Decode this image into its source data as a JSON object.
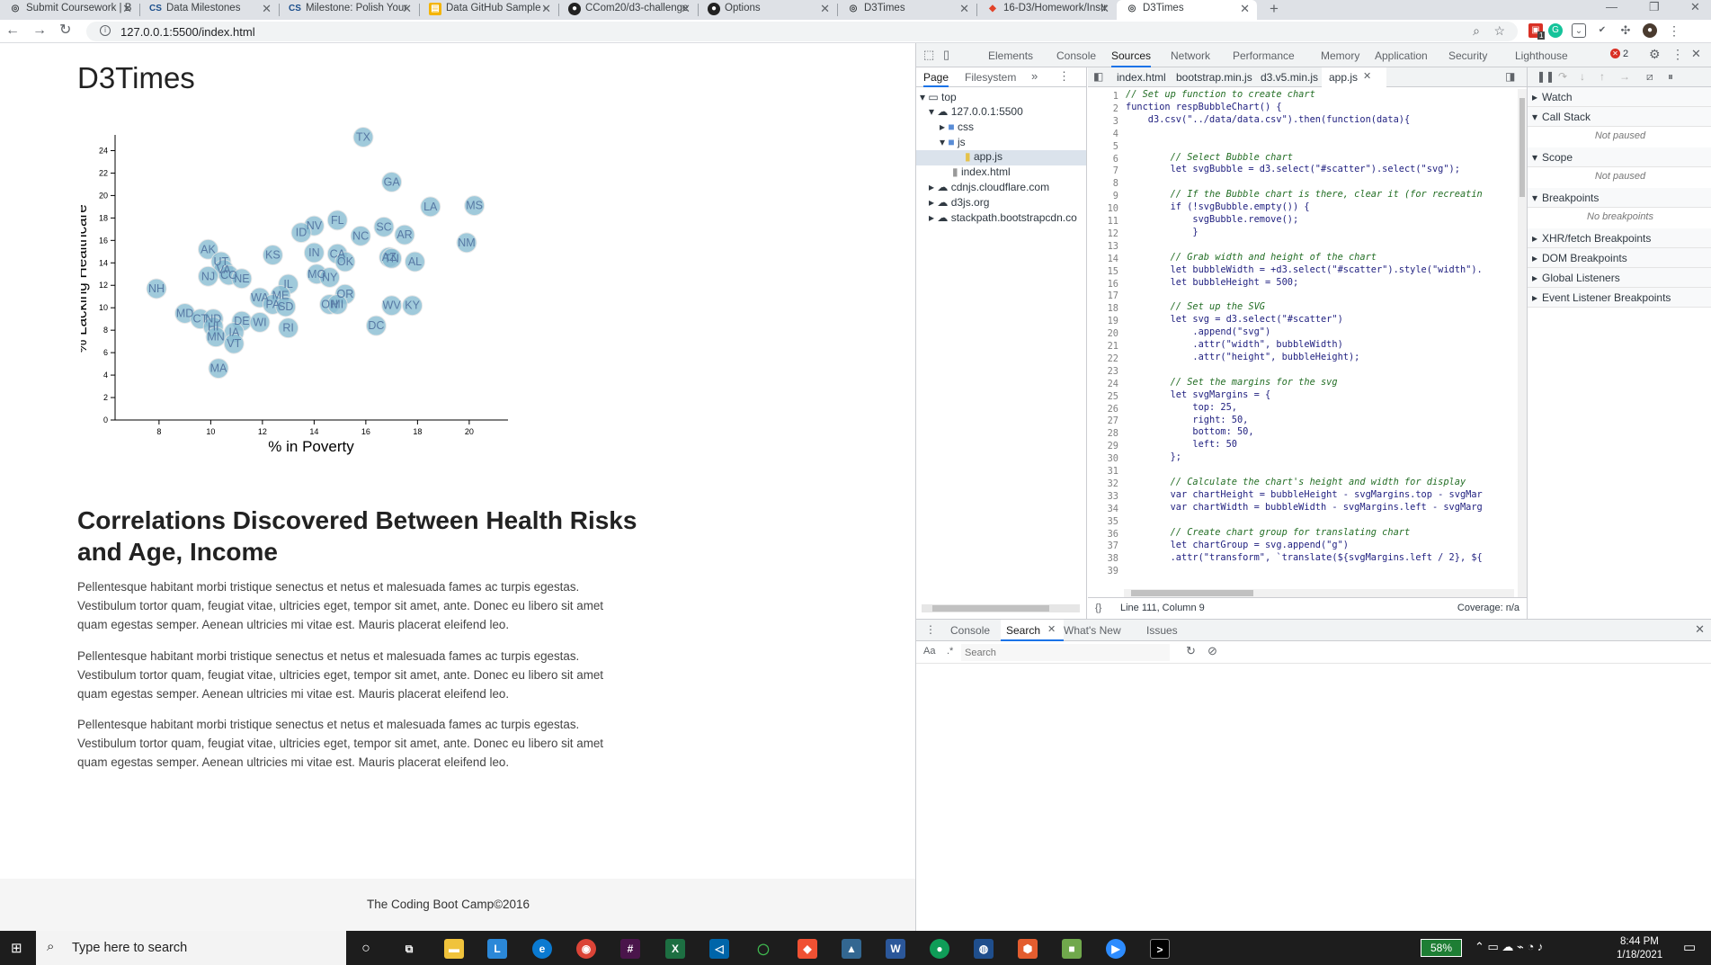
{
  "browser": {
    "tabs": [
      {
        "title": "Submit Coursework | B",
        "icon": "globe-icon"
      },
      {
        "title": "Data Milestones",
        "icon": "cs-icon"
      },
      {
        "title": "Milestone: Polish Your",
        "icon": "cs-icon"
      },
      {
        "title": "Data GitHub Sample - ",
        "icon": "doc-icon"
      },
      {
        "title": "CCom20/d3-challenge",
        "icon": "github-icon"
      },
      {
        "title": "Options",
        "icon": "github-icon"
      },
      {
        "title": "D3Times",
        "icon": "globe-icon"
      },
      {
        "title": "16-D3/Homework/Instr",
        "icon": "gitlab-icon"
      },
      {
        "title": "D3Times",
        "icon": "globe-icon"
      }
    ],
    "url": "127.0.0.1:5500/index.html",
    "ext_badge": "1"
  },
  "page": {
    "title": "D3Times",
    "heading": "Correlations Discovered Between Health Risks and Age, Income",
    "paragraphs": [
      "Pellentesque habitant morbi tristique senectus et netus et malesuada fames ac turpis egestas. Vestibulum tortor quam, feugiat vitae, ultricies eget, tempor sit amet, ante. Donec eu libero sit amet quam egestas semper. Aenean ultricies mi vitae est. Mauris placerat eleifend leo.",
      "Pellentesque habitant morbi tristique senectus et netus et malesuada fames ac turpis egestas. Vestibulum tortor quam, feugiat vitae, ultricies eget, tempor sit amet, ante. Donec eu libero sit amet quam egestas semper. Aenean ultricies mi vitae est. Mauris placerat eleifend leo.",
      "Pellentesque habitant morbi tristique senectus et netus et malesuada fames ac turpis egestas. Vestibulum tortor quam, feugiat vitae, ultricies eget, tempor sit amet, ante. Donec eu libero sit amet quam egestas semper. Aenean ultricies mi vitae est. Mauris placerat eleifend leo."
    ],
    "footer": "The Coding Boot Camp©2016"
  },
  "chart_data": {
    "type": "scatter",
    "xlabel": "% in Poverty",
    "ylabel": "% Lacking Healthcare",
    "xlim": [
      6.3,
      21.5
    ],
    "ylim": [
      0,
      25
    ],
    "xticks": [
      8,
      10,
      12,
      14,
      16,
      18,
      20
    ],
    "yticks": [
      0,
      2,
      4,
      6,
      8,
      10,
      12,
      14,
      16,
      18,
      20,
      22,
      24
    ],
    "points": [
      {
        "label": "TX",
        "x": 15.9,
        "y": 25.2
      },
      {
        "label": "GA",
        "x": 17.0,
        "y": 21.2
      },
      {
        "label": "LA",
        "x": 18.5,
        "y": 19.0
      },
      {
        "label": "MS",
        "x": 20.2,
        "y": 19.1
      },
      {
        "label": "FL",
        "x": 14.9,
        "y": 17.8
      },
      {
        "label": "NV",
        "x": 14.0,
        "y": 17.3
      },
      {
        "label": "ID",
        "x": 13.5,
        "y": 16.7
      },
      {
        "label": "SC",
        "x": 16.7,
        "y": 17.2
      },
      {
        "label": "NC",
        "x": 15.8,
        "y": 16.4
      },
      {
        "label": "AR",
        "x": 17.5,
        "y": 16.5
      },
      {
        "label": "NM",
        "x": 19.9,
        "y": 15.8
      },
      {
        "label": "AK",
        "x": 9.9,
        "y": 15.2
      },
      {
        "label": "KS",
        "x": 12.4,
        "y": 14.7
      },
      {
        "label": "IN",
        "x": 14.0,
        "y": 14.9
      },
      {
        "label": "CA",
        "x": 14.9,
        "y": 14.8
      },
      {
        "label": "AZ",
        "x": 16.9,
        "y": 14.5
      },
      {
        "label": "TN",
        "x": 17.0,
        "y": 14.4
      },
      {
        "label": "OK",
        "x": 15.2,
        "y": 14.1
      },
      {
        "label": "AL",
        "x": 17.9,
        "y": 14.1
      },
      {
        "label": "UT",
        "x": 10.4,
        "y": 14.1
      },
      {
        "label": "VA",
        "x": 10.5,
        "y": 13.4
      },
      {
        "label": "CO",
        "x": 10.7,
        "y": 12.9
      },
      {
        "label": "NE",
        "x": 11.2,
        "y": 12.6
      },
      {
        "label": "NJ",
        "x": 9.9,
        "y": 12.8
      },
      {
        "label": "MO",
        "x": 14.1,
        "y": 13.0
      },
      {
        "label": "NY",
        "x": 14.6,
        "y": 12.7
      },
      {
        "label": "IL",
        "x": 13.0,
        "y": 12.1
      },
      {
        "label": "NH",
        "x": 7.9,
        "y": 11.7
      },
      {
        "label": "WA",
        "x": 11.9,
        "y": 10.9
      },
      {
        "label": "ME",
        "x": 12.7,
        "y": 11.1
      },
      {
        "label": "OR",
        "x": 15.2,
        "y": 11.2
      },
      {
        "label": "PA",
        "x": 12.4,
        "y": 10.3
      },
      {
        "label": "SD",
        "x": 12.9,
        "y": 10.1
      },
      {
        "label": "OH",
        "x": 14.6,
        "y": 10.3
      },
      {
        "label": "MI",
        "x": 14.9,
        "y": 10.3
      },
      {
        "label": "WV",
        "x": 17.0,
        "y": 10.2
      },
      {
        "label": "KY",
        "x": 17.8,
        "y": 10.2
      },
      {
        "label": "MD",
        "x": 9.0,
        "y": 9.5
      },
      {
        "label": "CT",
        "x": 9.6,
        "y": 9.0
      },
      {
        "label": "ND",
        "x": 10.1,
        "y": 9.0
      },
      {
        "label": "DE",
        "x": 11.2,
        "y": 8.8
      },
      {
        "label": "WI",
        "x": 11.9,
        "y": 8.7
      },
      {
        "label": "HI",
        "x": 10.1,
        "y": 8.3
      },
      {
        "label": "DC",
        "x": 16.4,
        "y": 8.4
      },
      {
        "label": "RI",
        "x": 13.0,
        "y": 8.2
      },
      {
        "label": "IA",
        "x": 10.9,
        "y": 7.8
      },
      {
        "label": "MN",
        "x": 10.2,
        "y": 7.4
      },
      {
        "label": "VT",
        "x": 10.9,
        "y": 6.8
      },
      {
        "label": "MA",
        "x": 10.3,
        "y": 4.6
      }
    ]
  },
  "devtools": {
    "tabs": [
      "Elements",
      "Console",
      "Sources",
      "Network",
      "Performance",
      "Memory",
      "Application",
      "Security",
      "Lighthouse"
    ],
    "selected_tab": "Sources",
    "error_count": "2",
    "nav_tabs": [
      "Page",
      "Filesystem"
    ],
    "tree": [
      {
        "label": "top",
        "depth": 0,
        "icon": "window-icon"
      },
      {
        "label": "127.0.0.1:5500",
        "depth": 1,
        "icon": "cloud-icon"
      },
      {
        "label": "css",
        "depth": 2,
        "icon": "folder-icon"
      },
      {
        "label": "js",
        "depth": 2,
        "icon": "folder-icon"
      },
      {
        "label": "app.js",
        "depth": 3,
        "icon": "file-icon"
      },
      {
        "label": "index.html",
        "depth": 2,
        "icon": "file-icon"
      },
      {
        "label": "cdnjs.cloudflare.com",
        "depth": 1,
        "icon": "cloud-icon"
      },
      {
        "label": "d3js.org",
        "depth": 1,
        "icon": "cloud-icon"
      },
      {
        "label": "stackpath.bootstrapcdn.co",
        "depth": 1,
        "icon": "cloud-icon"
      }
    ],
    "editor_tabs": [
      "index.html",
      "bootstrap.min.js",
      "d3.v5.min.js",
      "app.js"
    ],
    "active_editor_tab": "app.js",
    "code_lines": [
      "// Set up function to create chart",
      "function respBubbleChart() {",
      "    d3.csv(\"../data/data.csv\").then(function(data){",
      "",
      "",
      "        // Select Bubble chart",
      "        let svgBubble = d3.select(\"#scatter\").select(\"svg\");",
      "",
      "        // If the Bubble chart is there, clear it (for recreatin",
      "        if (!svgBubble.empty()) {",
      "            svgBubble.remove();",
      "            }",
      "",
      "        // Grab width and height of the chart",
      "        let bubbleWidth = +d3.select(\"#scatter\").style(\"width\").",
      "        let bubbleHeight = 500;",
      "",
      "        // Set up the SVG",
      "        let svg = d3.select(\"#scatter\")",
      "            .append(\"svg\")",
      "            .attr(\"width\", bubbleWidth)",
      "            .attr(\"height\", bubbleHeight);",
      "",
      "        // Set the margins for the svg",
      "        let svgMargins = {",
      "            top: 25,",
      "            right: 50,",
      "            bottom: 50,",
      "            left: 50",
      "        };",
      "",
      "        // Calculate the chart's height and width for display",
      "        var chartHeight = bubbleHeight - svgMargins.top - svgMar",
      "        var chartWidth = bubbleWidth - svgMargins.left - svgMarg",
      "",
      "        // Create chart group for translating chart",
      "        let chartGroup = svg.append(\"g\")",
      "        .attr(\"transform\", `translate(${svgMargins.left / 2}, ${",
      ""
    ],
    "status": {
      "position": "Line 111, Column 9",
      "coverage": "Coverage: n/a"
    },
    "debug_sections": [
      {
        "label": "Watch",
        "note": ""
      },
      {
        "label": "Call Stack",
        "note": "Not paused"
      },
      {
        "label": "Scope",
        "note": "Not paused"
      },
      {
        "label": "Breakpoints",
        "note": "No breakpoints"
      },
      {
        "label": "XHR/fetch Breakpoints",
        "note": ""
      },
      {
        "label": "DOM Breakpoints",
        "note": ""
      },
      {
        "label": "Global Listeners",
        "note": ""
      },
      {
        "label": "Event Listener Breakpoints",
        "note": ""
      }
    ],
    "drawer_tabs": [
      "Console",
      "Search",
      "What's New",
      "Issues"
    ],
    "drawer_active": "Search",
    "search_placeholder": "Search",
    "search_aa": "Aa",
    "search_regex": ".*"
  },
  "taskbar": {
    "search_placeholder": "Type here to search",
    "battery": "58%",
    "time": "8:44 PM",
    "date": "1/18/2021"
  }
}
